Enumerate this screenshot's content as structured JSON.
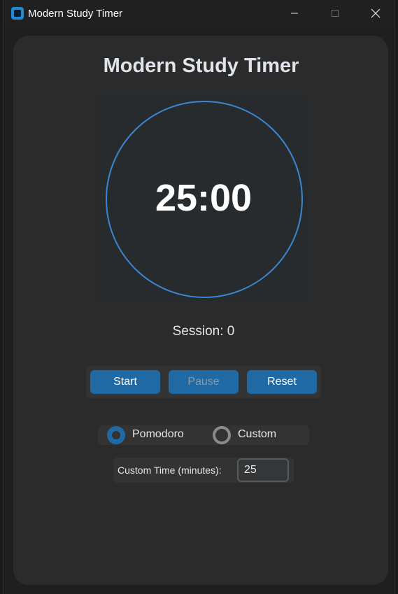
{
  "window": {
    "title": "Modern Study Timer",
    "icon": "app-icon"
  },
  "app": {
    "heading": "Modern Study Timer",
    "timer_display": "25:00",
    "session_text": "Session: 0",
    "ring_color": "#3a86d0"
  },
  "controls": {
    "start_label": "Start",
    "pause_label": "Pause",
    "reset_label": "Reset",
    "accent_color": "#1f6aa5"
  },
  "mode": {
    "options": [
      {
        "label": "Pomodoro",
        "selected": true
      },
      {
        "label": "Custom",
        "selected": false
      }
    ]
  },
  "custom_time": {
    "label": "Custom Time (minutes):",
    "value": "25"
  }
}
